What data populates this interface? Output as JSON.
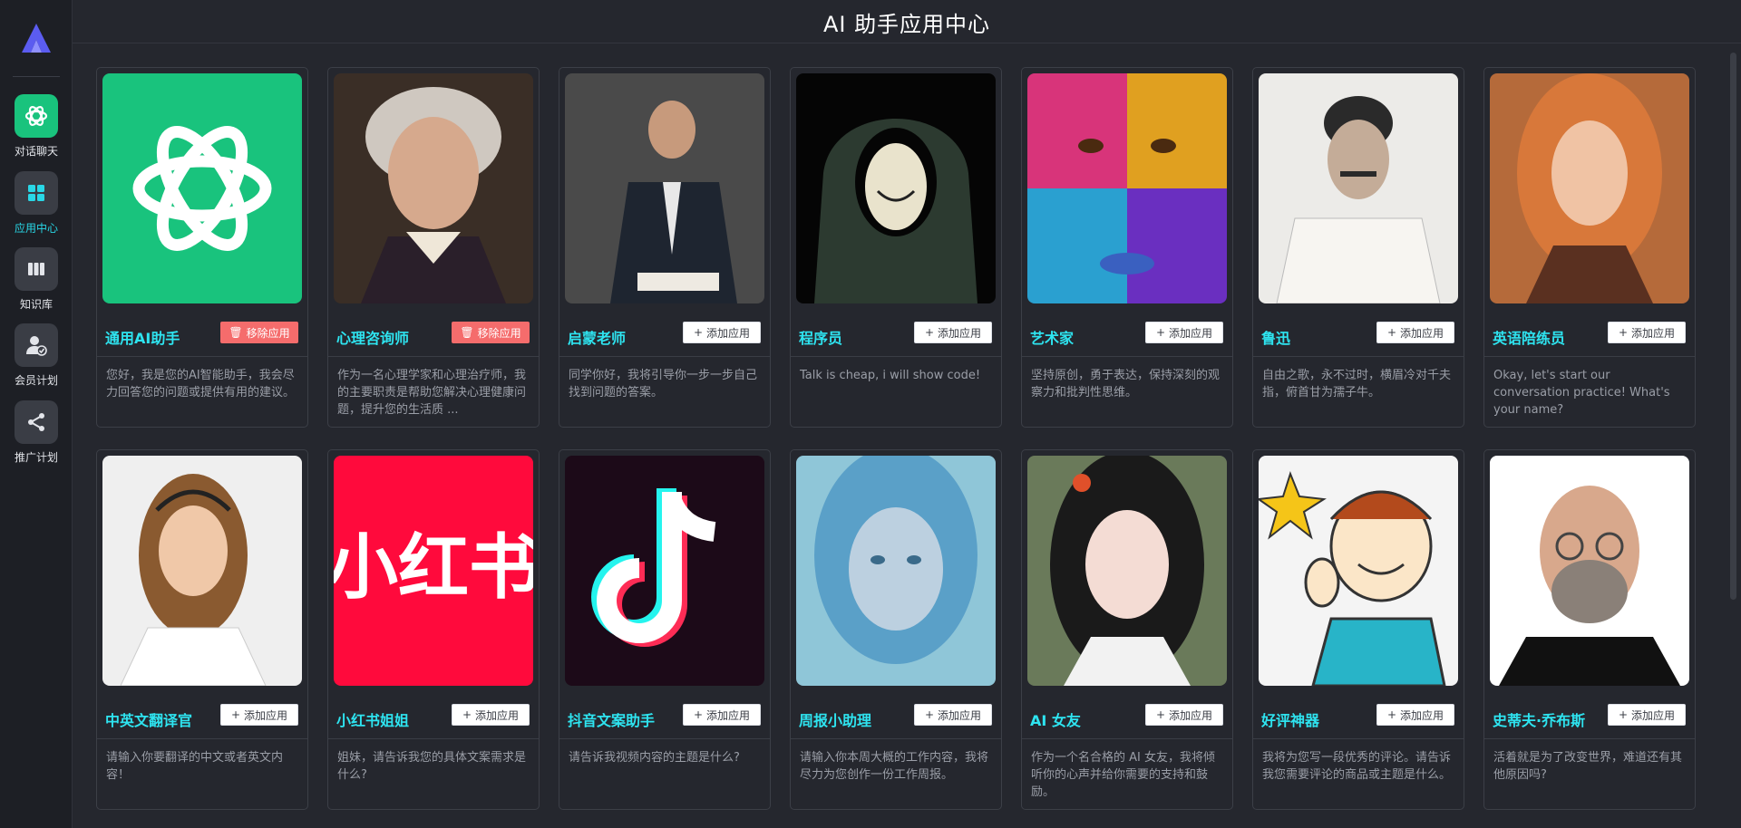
{
  "header": {
    "title": "AI 助手应用中心"
  },
  "sidebar": {
    "items": [
      {
        "label": "对话聊天",
        "icon": "openai-icon"
      },
      {
        "label": "应用中心",
        "icon": "grid-icon"
      },
      {
        "label": "知识库",
        "icon": "book-icon"
      },
      {
        "label": "会员计划",
        "icon": "member-icon"
      },
      {
        "label": "推广计划",
        "icon": "share-icon"
      }
    ]
  },
  "cards": [
    {
      "name": "通用AI助手",
      "button": "移除应用",
      "desc": "您好，我是您的AI智能助手，我会尽力回答您的问题或提供有用的建议。"
    },
    {
      "name": "心理咨询师",
      "button": "移除应用",
      "desc": "作为一名心理学家和心理治疗师，我的主要职责是帮助您解决心理健康问题，提升您的生活质 ..."
    },
    {
      "name": "启蒙老师",
      "button": "添加应用",
      "desc": "同学你好，我将引导你一步一步自己找到问题的答案。"
    },
    {
      "name": "程序员",
      "button": "添加应用",
      "desc": "Talk is cheap, i will show code!"
    },
    {
      "name": "艺术家",
      "button": "添加应用",
      "desc": "坚持原创，勇于表达，保持深刻的观察力和批判性思维。"
    },
    {
      "name": "鲁迅",
      "button": "添加应用",
      "desc": "自由之歌，永不过时，横眉冷对千夫指，俯首甘为孺子牛。"
    },
    {
      "name": "英语陪练员",
      "button": "添加应用",
      "desc": "Okay, let's start our conversation practice! What's your name?"
    },
    {
      "name": "中英文翻译官",
      "button": "添加应用",
      "desc": "请输入你要翻译的中文或者英文内容！"
    },
    {
      "name": "小红书姐姐",
      "button": "添加应用",
      "desc": "姐妹，请告诉我您的具体文案需求是什么?"
    },
    {
      "name": "抖音文案助手",
      "button": "添加应用",
      "desc": "请告诉我视频内容的主题是什么?"
    },
    {
      "name": "周报小助理",
      "button": "添加应用",
      "desc": "请输入你本周大概的工作内容，我将尽力为您创作一份工作周报。"
    },
    {
      "name": "AI 女友",
      "button": "添加应用",
      "desc": "作为一个名合格的 AI 女友，我将倾听你的心声并给你需要的支持和鼓励。"
    },
    {
      "name": "好评神器",
      "button": "添加应用",
      "desc": "我将为您写一段优秀的评论。请告诉我您需要评论的商品或主题是什么。"
    },
    {
      "name": "史蒂夫·乔布斯",
      "button": "添加应用",
      "desc": "活着就是为了改变世界，难道还有其他原因吗?"
    }
  ],
  "logos": {
    "xiaohongshu_text": "小红书"
  },
  "colors": {
    "accent": "#2ee4f0",
    "remove": "#f56c6c",
    "openai": "#19c37d",
    "xhs": "#ff0a3c"
  }
}
